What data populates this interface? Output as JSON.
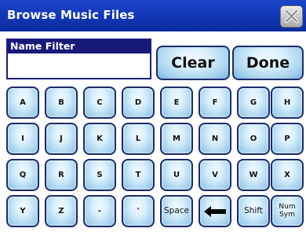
{
  "window": {
    "title": "Browse Music Files",
    "close_icon": "close-icon"
  },
  "filter": {
    "label": "Name Filter",
    "value": ""
  },
  "buttons": {
    "clear": "Clear",
    "done": "Done"
  },
  "keys": [
    [
      "A",
      "B",
      "C",
      "D",
      "E",
      "F",
      "G",
      "H"
    ],
    [
      "I",
      "J",
      "K",
      "L",
      "M",
      "N",
      "O",
      "P"
    ],
    [
      "Q",
      "R",
      "S",
      "T",
      "U",
      "V",
      "W",
      "X"
    ],
    [
      "Y",
      "Z",
      "-",
      "'",
      "Space",
      "backspace-arrow-icon",
      "Shift",
      "Num\nSym"
    ]
  ],
  "colors": {
    "title_bar": "#1236b4",
    "filter_label_bg": "#171a78",
    "key_fill": "#a8d3ee",
    "key_border": "#1d2c6a"
  }
}
